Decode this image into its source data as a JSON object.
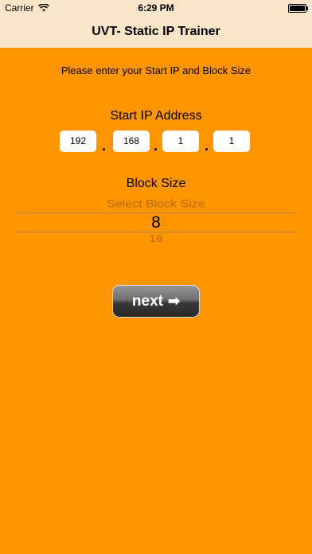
{
  "status": {
    "carrier": "Carrier",
    "time": "6:29 PM"
  },
  "nav": {
    "title": "UVT- Static IP Trainer"
  },
  "instruction": "Please enter your Start IP and Block Size",
  "start_ip": {
    "label": "Start IP Address",
    "octets": [
      "192",
      "168",
      "1",
      "1"
    ],
    "separator": "."
  },
  "block_size": {
    "label": "Block Size",
    "options": [
      "Select Block Size",
      "8",
      "16"
    ],
    "selected": "8"
  },
  "next_button": {
    "label": "next",
    "arrow": "➡"
  },
  "colors": {
    "background": "#FF9500",
    "nav_background": "#FBE5C9"
  }
}
